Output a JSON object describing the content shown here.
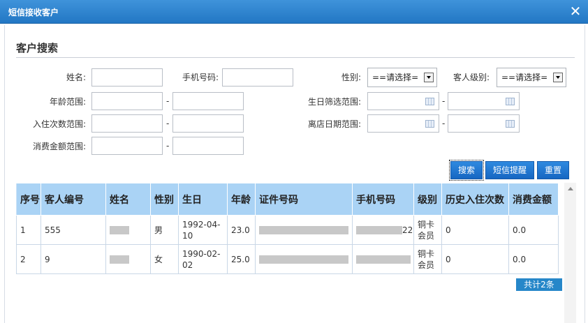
{
  "window": {
    "title": "短信接收客户",
    "close_glyph": "✕"
  },
  "search": {
    "heading": "客户搜索",
    "name_label": "姓名:",
    "phone_label": "手机号码:",
    "gender_label": "性别:",
    "gender_value": "==请选择=",
    "level_label": "客人级别:",
    "level_value": "==请选择=",
    "age_label": "年龄范围:",
    "birthday_label": "生日筛选范围:",
    "stays_label": "入住次数范围:",
    "leave_label": "离店日期范围:",
    "spend_label": "消费金额范围:",
    "dash": "-"
  },
  "buttons": {
    "search": "搜索",
    "sms_reminder": "短信提醒",
    "reset": "重置"
  },
  "table": {
    "columns": [
      "序号",
      "客人编号",
      "姓名",
      "性别",
      "生日",
      "年龄",
      "证件号码",
      "手机号码",
      "级别",
      "历史入住次数",
      "消费金额"
    ],
    "rows": [
      {
        "index": "1",
        "guest_no": "555",
        "name": "",
        "gender": "男",
        "birthday": "1992-04-10",
        "age": "23.0",
        "id_no": "",
        "phone": "22",
        "level": "铜卡会员",
        "stays": "0",
        "spend": "0.0"
      },
      {
        "index": "2",
        "guest_no": "9",
        "name": "",
        "gender": "女",
        "birthday": "1990-02-02",
        "age": "25.0",
        "id_no": "",
        "phone": "",
        "level": "铜卡会员",
        "stays": "0",
        "spend": "0.0"
      }
    ],
    "total": "共计2条"
  },
  "colors": {
    "title_bar": "#2a80cc",
    "header_bg": "#aad3f5",
    "button": "#1f77d0"
  }
}
